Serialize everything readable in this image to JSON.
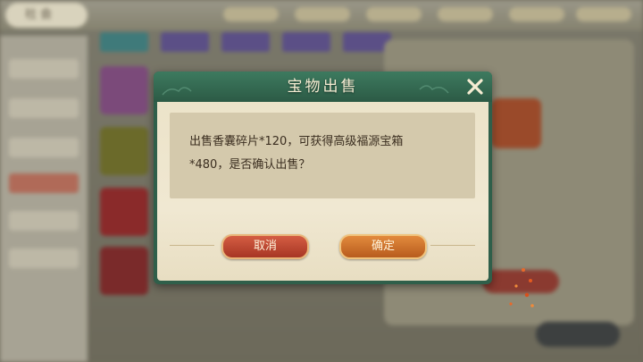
{
  "background": {
    "back_label": "社 会"
  },
  "modal": {
    "title": "宝物出售",
    "message_line1": "出售香囊碎片*120，可获得高级福源宝箱",
    "message_line2": "*480，是否确认出售？",
    "cancel_label": "取消",
    "confirm_label": "确定",
    "close_icon": "close-x-icon"
  },
  "colors": {
    "title_bar": "#3d7a5f",
    "cancel_button": "#c24a33",
    "confirm_button": "#d17630",
    "message_text": "#3b2e20"
  }
}
